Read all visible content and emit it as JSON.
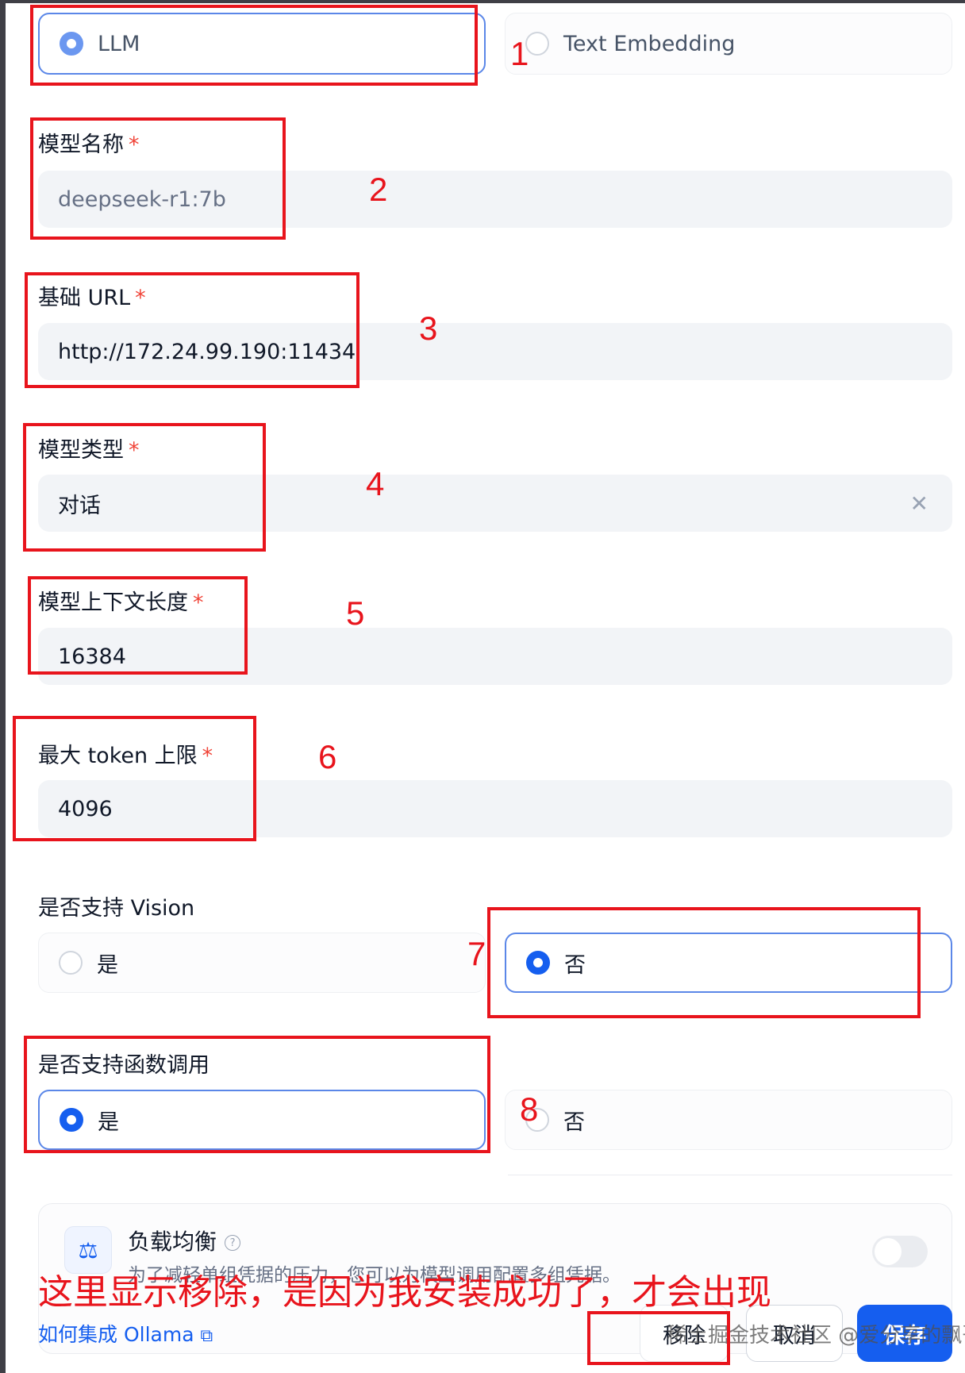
{
  "model_type_options": [
    {
      "label": "LLM",
      "selected": true
    },
    {
      "label": "Text Embedding",
      "selected": false
    }
  ],
  "fields": {
    "model_name": {
      "label": "模型名称",
      "required": "*",
      "placeholder": "deepseek-r1:7b"
    },
    "base_url": {
      "label": "基础 URL",
      "required": "*",
      "value": "http://172.24.99.190:11434"
    },
    "model_category": {
      "label": "模型类型",
      "required": "*",
      "value": "对话",
      "clear_icon": "close-icon"
    },
    "context_length": {
      "label": "模型上下文长度",
      "required": "*",
      "value": "16384"
    },
    "max_tokens": {
      "label": "最大 token 上限",
      "required": "*",
      "value": "4096"
    }
  },
  "vision": {
    "label": "是否支持 Vision",
    "options": [
      {
        "label": "是",
        "selected": false
      },
      {
        "label": "否",
        "selected": true
      }
    ]
  },
  "function_call": {
    "label": "是否支持函数调用",
    "options": [
      {
        "label": "是",
        "selected": true
      },
      {
        "label": "否",
        "selected": false
      }
    ]
  },
  "load_balance": {
    "title": "负载均衡",
    "help_icon": "question-circle-icon",
    "icon": "balance-scale-icon",
    "description": "为了减轻单组凭据的压力，您可以为模型调用配置多组凭据。",
    "enabled": false
  },
  "footer": {
    "help_link": "如何集成 Ollama",
    "help_link_icon": "external-link-icon",
    "remove_label": "移除",
    "cancel_label": "取消",
    "save_label": "保存"
  },
  "watermark": "稀土掘金技术社区 @爱分享的飘哥",
  "annotations": {
    "numbers": [
      "1",
      "2",
      "3",
      "4",
      "5",
      "6",
      "7",
      "8"
    ],
    "caption": "这里显示移除，是因为我安装成功了，才会出现",
    "color": "#e8141c"
  },
  "colors": {
    "accent": "#155eef",
    "input_bg": "#f2f4f7",
    "required": "#f04438"
  }
}
